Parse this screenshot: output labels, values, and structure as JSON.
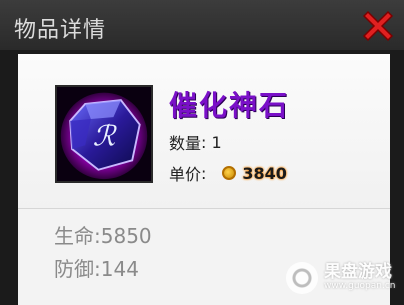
{
  "window": {
    "title": "物品详情",
    "close_icon": "close-x-icon"
  },
  "item": {
    "name": "催化神石",
    "icon": "purple-gem-icon",
    "quantity_label": "数量",
    "quantity_value": "1",
    "price_label": "单价",
    "price_value": "3840",
    "currency_icon": "gold-coin-icon"
  },
  "attributes": [
    {
      "label": "生命",
      "value": "5850"
    },
    {
      "label": "防御",
      "value": "144"
    }
  ],
  "watermark": {
    "name": "果盘游戏",
    "url": "www.guopan.cn"
  },
  "colors": {
    "item_name": "#7a10c8",
    "close_icon": "#e02020",
    "coin": "#e6a400"
  }
}
